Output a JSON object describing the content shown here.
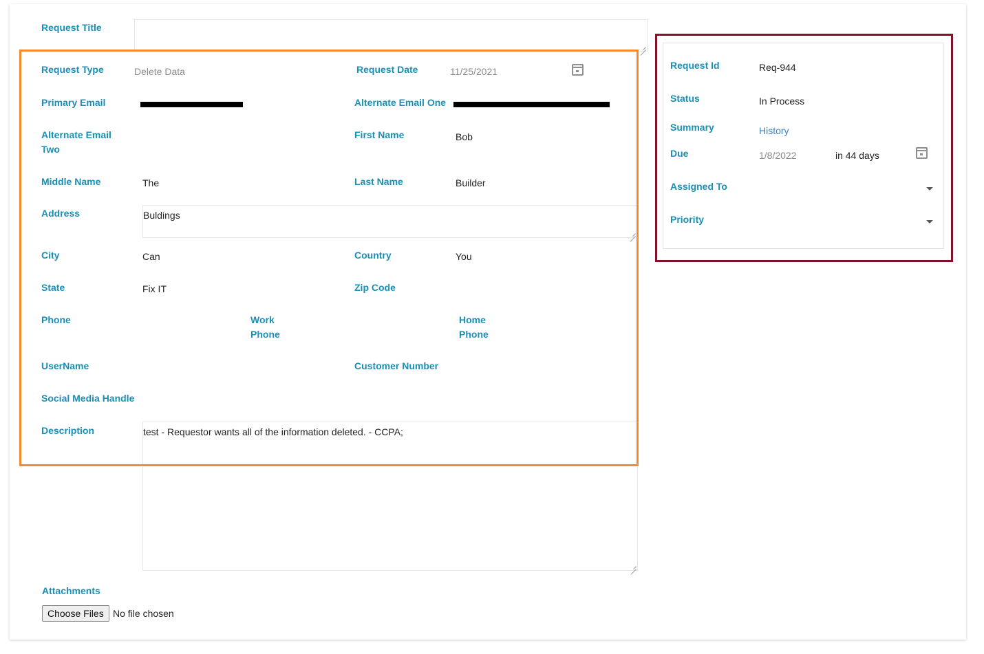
{
  "form": {
    "request_title_label": "Request Title",
    "request_type_label": "Request Type",
    "request_type_value": "Delete Data",
    "request_date_label": "Request Date",
    "request_date_value": "11/25/2021",
    "primary_email_label": "Primary Email",
    "alternate_email_one_label": "Alternate Email One",
    "alternate_email_two_label_line1": "Alternate Email",
    "alternate_email_two_label_line2": "Two",
    "first_name_label": "First Name",
    "first_name_value": "Bob",
    "middle_name_label": "Middle Name",
    "middle_name_value": "The",
    "last_name_label": "Last Name",
    "last_name_value": "Builder",
    "address_label": "Address",
    "address_value": "Buldings",
    "city_label": "City",
    "city_value": "Can",
    "country_label": "Country",
    "country_value": "You",
    "state_label": "State",
    "state_value": "Fix IT",
    "zip_label": "Zip Code",
    "phone_label": "Phone",
    "work_phone_label_line1": "Work",
    "work_phone_label_line2": "Phone",
    "home_phone_label_line1": "Home",
    "home_phone_label_line2": "Phone",
    "username_label": "UserName",
    "customer_number_label": "Customer Number",
    "social_label": "Social Media Handle",
    "description_label": "Description",
    "description_value": "test - Requestor wants all of the information deleted. - CCPA;",
    "attachments_label": "Attachments",
    "choose_files_label": "Choose Files",
    "no_file_text": "No file chosen"
  },
  "side": {
    "request_id_label": "Request Id",
    "request_id_value": "Req-944",
    "status_label": "Status",
    "status_value": "In Process",
    "summary_label": "Summary",
    "summary_link": "History",
    "due_label": "Due",
    "due_value": "1/8/2022",
    "due_relative": "in 44 days",
    "assigned_label": "Assigned To",
    "priority_label": "Priority"
  },
  "colors": {
    "label": "#1a8fb5",
    "highlight_orange": "#f58a2e",
    "highlight_red": "#7e1427"
  },
  "icons": [
    "calendar-icon",
    "chevron-down-icon",
    "resize-grip-icon"
  ]
}
